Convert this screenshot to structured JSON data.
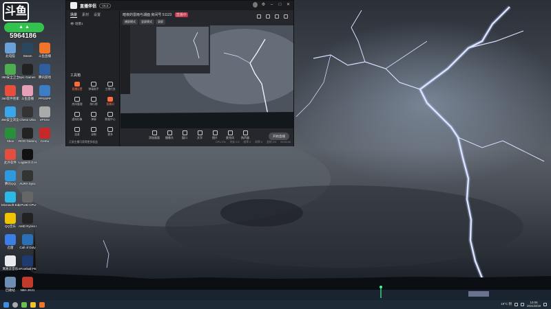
{
  "overlay": {
    "logo_text": "斗鱼",
    "viewer_count": "5964186"
  },
  "desktop": {
    "icons": [
      {
        "label": "此电脑",
        "icon": "computer-icon",
        "color": "#6aa0d8"
      },
      {
        "label": "360安全卫士",
        "icon": "shield-icon",
        "color": "#4cae4f"
      },
      {
        "label": "360软件管家",
        "icon": "app-store-icon",
        "color": "#e94e3c"
      },
      {
        "label": "360安全浏览器",
        "icon": "browser-icon",
        "color": "#3aa5e8"
      },
      {
        "label": "Xbox",
        "icon": "xbox-icon",
        "color": "#2a8f3a"
      },
      {
        "label": "此外软件",
        "icon": "folder-icon",
        "color": "#e34e3e"
      },
      {
        "label": "腾讯QQ",
        "icon": "qq-icon",
        "color": "#2d9ae0"
      },
      {
        "label": "Microsoft Edge",
        "icon": "edge-icon",
        "color": "#2db9e6"
      },
      {
        "label": "QQ音乐",
        "icon": "music-icon",
        "color": "#f0c300"
      },
      {
        "label": "迅雷",
        "icon": "thunder-icon",
        "color": "#3c7ee8"
      },
      {
        "label": "网易云音乐",
        "icon": "cloud-music-icon",
        "color": "#e8eaec"
      },
      {
        "label": "回收站",
        "icon": "recycle-bin-icon",
        "color": "#6d8fb3"
      },
      {
        "label": "Steam",
        "icon": "steam-icon",
        "color": "#2a475e"
      },
      {
        "label": "Epic Games Launcher",
        "icon": "epic-icon",
        "color": "#222222"
      },
      {
        "label": "斗鱼直播",
        "icon": "anime-icon",
        "color": "#e59fb7"
      },
      {
        "label": "Chess Ultra",
        "icon": "chess-icon",
        "color": "#333333"
      },
      {
        "label": "ROG Gaming",
        "icon": "rog-icon",
        "color": "#222222"
      },
      {
        "label": "Logitech G HUB",
        "icon": "logitech-icon",
        "color": "#111111"
      },
      {
        "label": "AURA Sync",
        "icon": "aura-icon",
        "color": "#333333"
      },
      {
        "label": "CPUID CPU-Z",
        "icon": "cpuz-icon",
        "color": "#666666"
      },
      {
        "label": "AMD Ryzen Master",
        "icon": "amd-icon",
        "color": "#222222"
      },
      {
        "label": "Call of Duty",
        "icon": "game-icon",
        "color": "#2b6fb5"
      },
      {
        "label": "eFootball PES 2021",
        "icon": "football-icon",
        "color": "#1f3a6e"
      },
      {
        "label": "NBA 2K21",
        "icon": "basketball-icon",
        "color": "#c0392b"
      },
      {
        "label": "斗鱼直播",
        "icon": "douyu-icon",
        "color": "#f2742a"
      },
      {
        "label": "腾讯游戏",
        "icon": "game-pad-icon",
        "color": "#2e5e9e"
      },
      {
        "label": "PPSSPP",
        "icon": "psp-icon",
        "color": "#3b7ec6"
      },
      {
        "label": "ePSXe",
        "icon": "controller-icon",
        "color": "#aaaaaa"
      },
      {
        "label": "Cemu",
        "icon": "red-circle-icon",
        "color": "#c62828"
      }
    ]
  },
  "app": {
    "name": "直播伴侣",
    "version": "V5.0",
    "window_controls": [
      "最小化",
      "最大化",
      "关闭"
    ],
    "left_tabs": [
      "场景",
      "素材",
      "设置"
    ],
    "scene_label": "场景1",
    "tools_title": "工具箱",
    "tools": [
      {
        "label": "直播设置",
        "hot": true
      },
      {
        "label": "弹幕助手",
        "hot": false
      },
      {
        "label": "主播任务",
        "hot": false
      },
      {
        "label": "房间管理",
        "hot": false
      },
      {
        "label": "排行榜",
        "hot": false
      },
      {
        "label": "直播间",
        "hot": true
      },
      {
        "label": "虚拟形象",
        "hot": false
      },
      {
        "label": "弹幕",
        "hot": false
      },
      {
        "label": "数据中心",
        "hot": false
      },
      {
        "label": "连麦",
        "hot": false
      },
      {
        "label": "录制",
        "hot": false
      },
      {
        "label": "更多",
        "hot": false
      }
    ],
    "left_footer": "订阅主播可获得更多权益",
    "stream_title": "暗夜的雷雨与湖面",
    "stream_id": "房间号 51123",
    "live_tag": "直播中",
    "mode_tabs": [
      "横屏模式",
      "竖屏模式",
      "录屏"
    ],
    "controls": [
      "添加画面",
      "摄像头",
      "窗口",
      "文字",
      "图片",
      "麦克风",
      "扬声器"
    ],
    "live_button": "开始直播",
    "status": [
      "CPU 2%",
      "内存 0.5",
      "帧率 0",
      "码率 0",
      "丢帧 0%",
      "00:00:00"
    ]
  },
  "taskbar": {
    "weather": "19°C 阴",
    "time": "10:06",
    "date": "2021/8/19"
  },
  "colors": {
    "accent_orange": "#ff6b3d",
    "live_red": "#c8364a",
    "badge_green": "#32c24d"
  }
}
